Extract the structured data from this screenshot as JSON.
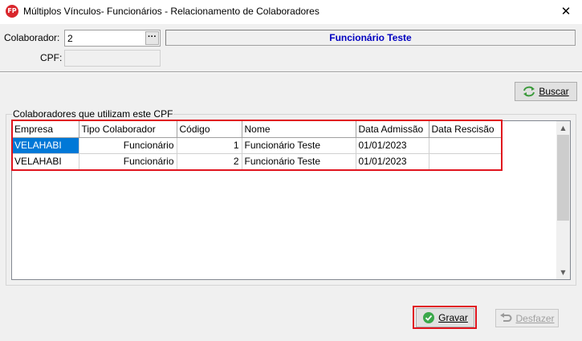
{
  "window": {
    "icon_text": "FP",
    "title": "Múltiplos Vínculos- Funcionários - Relacionamento de Colaboradores",
    "close_glyph": "✕"
  },
  "form": {
    "colaborador_label": "Colaborador:",
    "colaborador_value": "2",
    "lookup_button_label": "···",
    "colaborador_name": "Funcionário Teste",
    "cpf_label": "CPF:",
    "cpf_value": ""
  },
  "buscar_button": {
    "label": "Buscar",
    "icon": "refresh-arrows-icon"
  },
  "group": {
    "title": "Colaboradores que utilizam este CPF",
    "columns": [
      "Empresa",
      "Tipo Colaborador",
      "Código",
      "Nome",
      "Data Admissão",
      "Data Rescisão"
    ],
    "rows": [
      {
        "empresa": "VELAHABI",
        "tipo": "Funcionário",
        "codigo": "1",
        "nome": "Funcionário Teste",
        "admissao": "01/01/2023",
        "rescisao": ""
      },
      {
        "empresa": "VELAHABI",
        "tipo": "Funcionário",
        "codigo": "2",
        "nome": "Funcionário Teste",
        "admissao": "01/01/2023",
        "rescisao": ""
      }
    ]
  },
  "scrollbar": {
    "up_glyph": "▲",
    "down_glyph": "▼"
  },
  "footer": {
    "gravar_label": "Gravar",
    "gravar_icon": "check-circle-icon",
    "desfazer_label": "Desfazer",
    "desfazer_icon": "undo-icon"
  },
  "colors": {
    "highlight_border": "#e0141e",
    "selection": "#0078d7",
    "name_text": "#0000c0",
    "gravar_icon": "#3aa84a"
  }
}
